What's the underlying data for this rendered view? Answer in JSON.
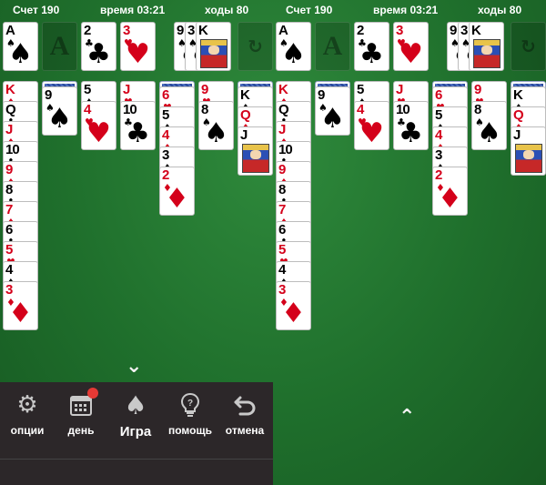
{
  "hud": {
    "score_label": "Счет",
    "score": "190",
    "time_label": "время",
    "time": "03:21",
    "moves_label": "ходы",
    "moves": "80"
  },
  "top_row": {
    "foundation_1": {
      "rank": "A",
      "suit": "♠",
      "color": "black"
    },
    "foundation_2_placeholder": "A",
    "foundation_3": {
      "rank": "2",
      "suit": "♣",
      "color": "black"
    },
    "foundation_4": {
      "rank": "3",
      "suit": "♥",
      "color": "red"
    },
    "waste": [
      {
        "rank": "9",
        "suit": "♠",
        "color": "black"
      },
      {
        "rank": "3",
        "suit": "♠",
        "color": "black"
      },
      {
        "rank": "K",
        "suit": "♠",
        "color": "black"
      }
    ],
    "stock_icon": "refresh-icon"
  },
  "tableau": [
    {
      "hidden": 0,
      "cards": [
        {
          "rank": "K",
          "suit": "♦",
          "color": "red"
        },
        {
          "rank": "Q",
          "suit": "♣",
          "color": "black"
        },
        {
          "rank": "J",
          "suit": "♦",
          "color": "red"
        },
        {
          "rank": "10",
          "suit": "♣",
          "color": "black"
        },
        {
          "rank": "9",
          "suit": "♦",
          "color": "red"
        },
        {
          "rank": "8",
          "suit": "♣",
          "color": "black"
        },
        {
          "rank": "7",
          "suit": "♦",
          "color": "red"
        },
        {
          "rank": "6",
          "suit": "♣",
          "color": "black"
        },
        {
          "rank": "5",
          "suit": "♥",
          "color": "red"
        },
        {
          "rank": "4",
          "suit": "♠",
          "color": "black"
        },
        {
          "rank": "3",
          "suit": "♦",
          "color": "red"
        }
      ]
    },
    {
      "hidden": 1,
      "cards": [
        {
          "rank": "9",
          "suit": "♠",
          "color": "black"
        }
      ]
    },
    {
      "hidden": 0,
      "cards": [
        {
          "rank": "5",
          "suit": "♠",
          "color": "black"
        },
        {
          "rank": "4",
          "suit": "♥",
          "color": "red"
        }
      ]
    },
    {
      "hidden": 0,
      "cards": [
        {
          "rank": "J",
          "suit": "♥",
          "color": "red"
        },
        {
          "rank": "10",
          "suit": "♣",
          "color": "black"
        }
      ]
    },
    {
      "hidden": 1,
      "cards": [
        {
          "rank": "6",
          "suit": "♥",
          "color": "red"
        },
        {
          "rank": "5",
          "suit": "♠",
          "color": "black"
        },
        {
          "rank": "4",
          "suit": "♦",
          "color": "red"
        },
        {
          "rank": "3",
          "suit": "♠",
          "color": "black"
        },
        {
          "rank": "2",
          "suit": "♦",
          "color": "red"
        }
      ]
    },
    {
      "hidden": 0,
      "cards": [
        {
          "rank": "9",
          "suit": "♥",
          "color": "red"
        },
        {
          "rank": "8",
          "suit": "♠",
          "color": "black"
        }
      ]
    },
    {
      "hidden": 1,
      "cards": [
        {
          "rank": "K",
          "suit": "♠",
          "color": "black"
        },
        {
          "rank": "Q",
          "suit": "♦",
          "color": "red"
        },
        {
          "rank": "J",
          "suit": "♣",
          "color": "black",
          "face": true
        }
      ]
    }
  ],
  "menu": {
    "items": [
      {
        "label": "опции",
        "icon": "gear-icon"
      },
      {
        "label": "день",
        "icon": "calendar-icon"
      },
      {
        "label": "Игра",
        "icon": "spade-icon"
      },
      {
        "label": "помощь",
        "icon": "lightbulb-icon"
      },
      {
        "label": "отмена",
        "icon": "undo-icon"
      }
    ]
  },
  "colors": {
    "felt": "#1f6f2c",
    "red_suit": "#d4001a",
    "menu_bg": "#2c2729",
    "badge": "#e53935"
  }
}
